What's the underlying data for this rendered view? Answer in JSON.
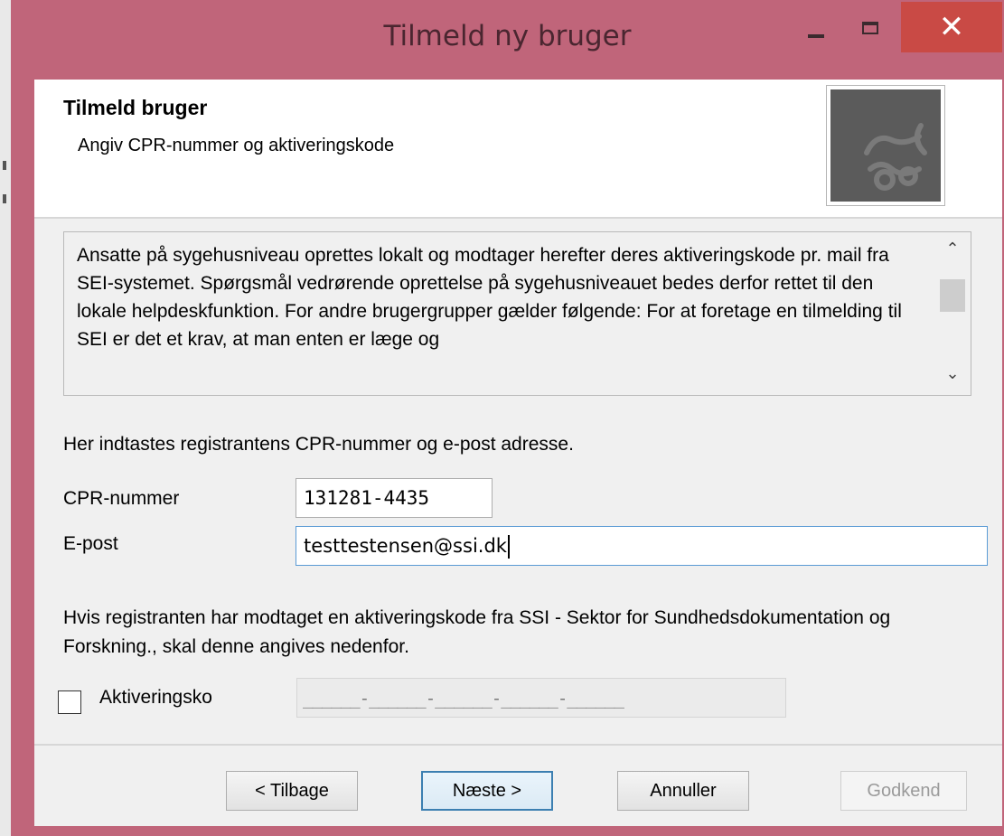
{
  "window": {
    "title": "Tilmeld ny bruger",
    "close_glyph": "✕"
  },
  "header": {
    "title": "Tilmeld bruger",
    "subtitle": "Angiv CPR-nummer og aktiveringskode",
    "logo_icon": "crown-logo-icon"
  },
  "info": {
    "text": "Ansatte på sygehusniveau oprettes lokalt og modtager herefter deres aktiveringskode pr. mail fra SEI-systemet. Spørgsmål vedrørende oprettelse på sygehusniveauet bedes derfor rettet til den lokale helpdeskfunktion. For andre brugergrupper gælder følgende: For at foretage en tilmelding til SEI er det et krav, at man enten er læge og",
    "scroll_up": "⌃",
    "scroll_down": "⌄"
  },
  "form": {
    "intro": "Her indtastes registrantens CPR-nummer og e-post adresse.",
    "cpr_label": "CPR-nummer",
    "cpr_value": "131281-4435",
    "epost_label": "E-post",
    "epost_value": "testtestensen@ssi.dk",
    "hint": "Hvis registranten har modtaget en aktiveringskode fra SSI - Sektor for Sundhedsdokumentation og Forskning., skal denne angives nedenfor.",
    "activation_label": "Aktiveringsko",
    "activation_mask": "______-______-______-______-______",
    "activation_checked": false
  },
  "buttons": {
    "back": "< Tilbage",
    "next": "Næste >",
    "cancel": "Annuller",
    "approve": "Godkend"
  },
  "colors": {
    "frame": "#c0657a",
    "close": "#c94a45",
    "accent": "#3c7fb1"
  }
}
